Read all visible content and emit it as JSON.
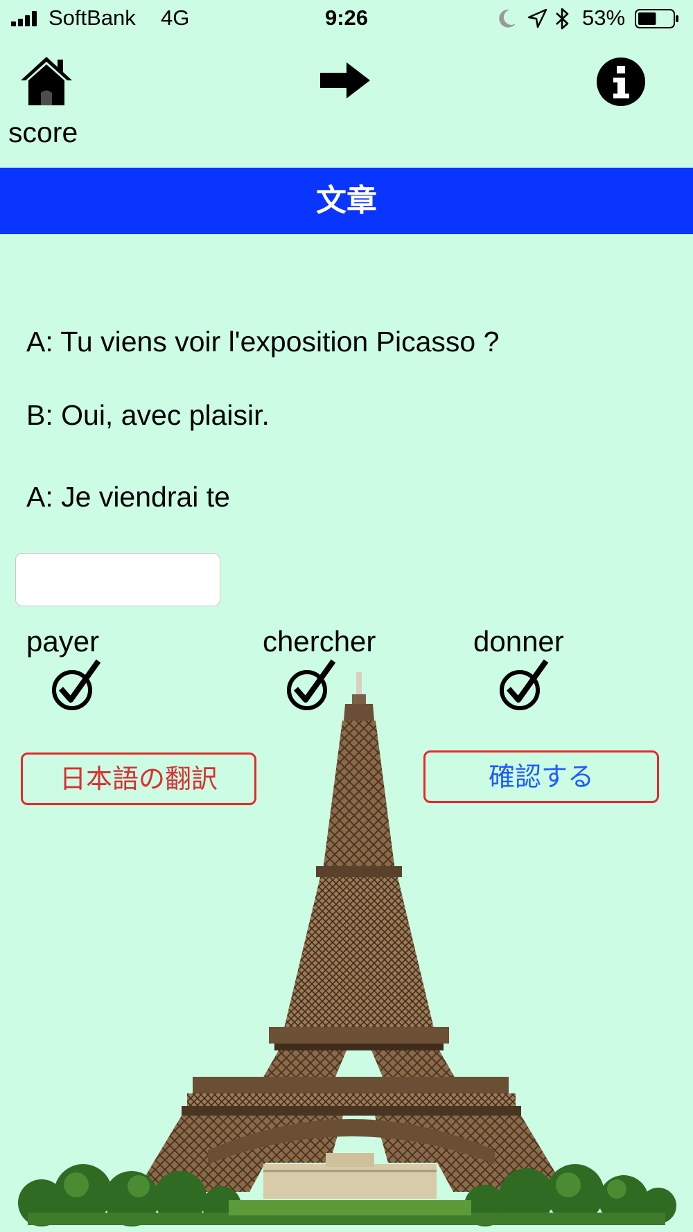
{
  "status_bar": {
    "carrier": "SoftBank",
    "network": "4G",
    "time": "9:26",
    "battery": "53%",
    "battery_level": 0.53
  },
  "nav": {
    "home_icon": "home-icon",
    "score_label": "score",
    "next_icon": "arrow-right-icon",
    "info_icon": "info-icon"
  },
  "header": {
    "title": "文章"
  },
  "dialogue": {
    "line1": "A: Tu viens voir l'exposition Picasso ?",
    "line2": "B: Oui, avec plaisir.",
    "line3": "A: Je viendrai te"
  },
  "answer": {
    "value": "",
    "placeholder": ""
  },
  "choices": [
    {
      "label": "payer",
      "icon": "checkmark-icon"
    },
    {
      "label": "chercher",
      "icon": "checkmark-icon"
    },
    {
      "label": "donner",
      "icon": "checkmark-icon"
    }
  ],
  "buttons": {
    "translate": "日本語の翻訳",
    "confirm": "確認する"
  },
  "colors": {
    "background": "#ccfde4",
    "header_bar": "#0a35ff",
    "translate_text": "#d93030",
    "confirm_text": "#1f5cff",
    "button_border": "#e52a2a"
  }
}
